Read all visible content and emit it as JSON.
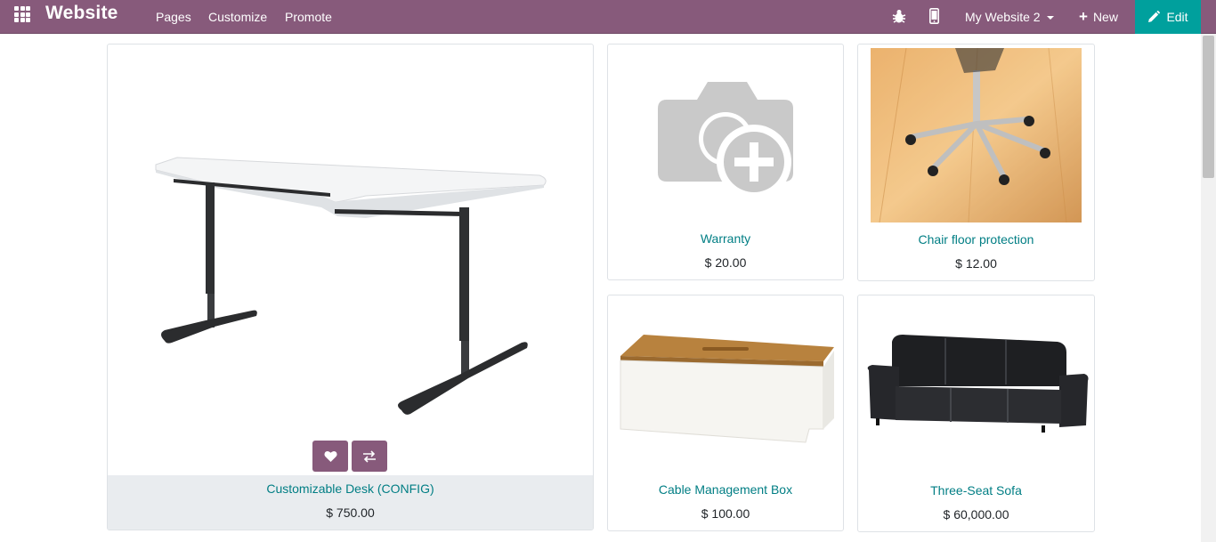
{
  "navbar": {
    "brand": "Website",
    "menu": [
      "Pages",
      "Customize",
      "Promote"
    ],
    "icons": {
      "apps": "apps-grid-icon",
      "debug": "bug-icon",
      "mobile": "mobile-phone-icon"
    },
    "website_selector": "My Website 2",
    "new_label": "New",
    "edit_label": "Edit",
    "colors": {
      "bar": "#875a7b",
      "edit": "#00a09d"
    }
  },
  "products": [
    {
      "name": "Customizable Desk (CONFIG)",
      "price": "$ 750.00"
    },
    {
      "name": "Warranty",
      "price": "$ 20.00"
    },
    {
      "name": "Chair floor protection",
      "price": "$ 12.00"
    },
    {
      "name": "Cable Management Box",
      "price": "$ 100.00"
    },
    {
      "name": "Three-Seat Sofa",
      "price": "$ 60,000.00"
    }
  ],
  "product_actions": {
    "wishlist_icon": "heart-icon",
    "compare_icon": "exchange-arrows-icon"
  },
  "link_color": "#017e84"
}
